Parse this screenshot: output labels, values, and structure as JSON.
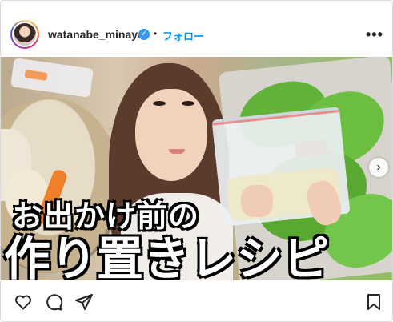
{
  "header": {
    "username": "watanabe_minayo",
    "verified_mark": "✓",
    "separator": "•",
    "follow_label": "フォロー",
    "more_label": "•••"
  },
  "media": {
    "title_line1": "お出かけ前の",
    "title_line2": "作り置きレシピ",
    "carousel_next": "›"
  },
  "actions": {
    "icons": [
      "heart-icon",
      "comment-icon",
      "share-icon",
      "bookmark-icon"
    ]
  },
  "colors": {
    "accent": "#0095f6",
    "verified": "#3897f0",
    "text": "#262626",
    "border": "#dbdbdb"
  }
}
